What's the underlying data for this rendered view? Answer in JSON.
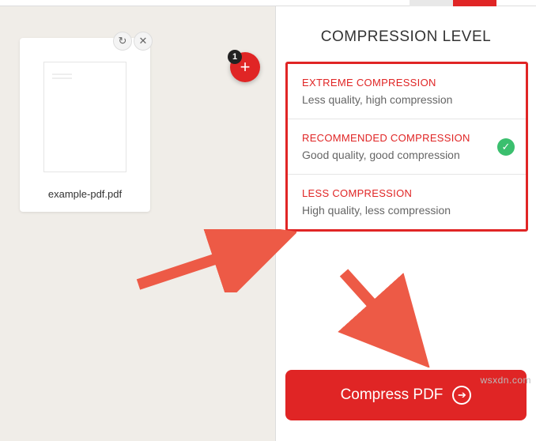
{
  "file": {
    "name": "example-pdf.pdf",
    "count": "1"
  },
  "panel": {
    "title": "COMPRESSION LEVEL"
  },
  "options": [
    {
      "title": "EXTREME COMPRESSION",
      "desc": "Less quality, high compression",
      "selected": false
    },
    {
      "title": "RECOMMENDED COMPRESSION",
      "desc": "Good quality, good compression",
      "selected": true
    },
    {
      "title": "LESS COMPRESSION",
      "desc": "High quality, less compression",
      "selected": false
    }
  ],
  "action": {
    "label": "Compress PDF"
  },
  "watermark": "wsxdn.com",
  "colors": {
    "accent": "#e02525",
    "success": "#3bbf6e"
  }
}
